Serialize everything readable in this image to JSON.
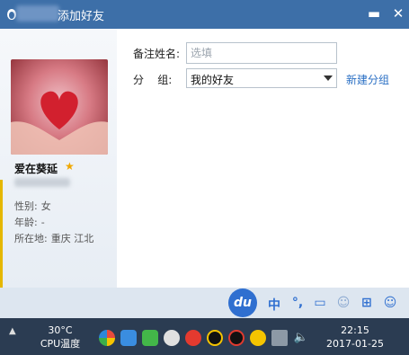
{
  "window": {
    "title": "添加好友",
    "minimize_glyph": "▬",
    "close_glyph": "✕"
  },
  "profile": {
    "nickname": "爱在葵延",
    "gender_label": "性别:",
    "gender_value": "女",
    "age_label": "年龄:",
    "age_value": "-",
    "location_label": "所在地:",
    "location_value": "重庆  江北"
  },
  "form": {
    "remark_label": "备注姓名:",
    "remark_placeholder": "选填",
    "remark_value": "",
    "group_label": "分    组:",
    "group_value": "我的好友",
    "new_group_link": "新建分组"
  },
  "ime": {
    "logo": "du",
    "items": [
      "中",
      "°,",
      "▭",
      "☺",
      "⊞",
      "☺"
    ]
  },
  "taskbar": {
    "temp_value": "30°C",
    "temp_label": "CPU温度",
    "time": "22:15",
    "date": "2017-01-25"
  },
  "colors": {
    "titlebar": "#3d6fa8",
    "link": "#2a6fc4",
    "ime_blue": "#2f6fd0",
    "taskbar": "#2b3c52"
  }
}
